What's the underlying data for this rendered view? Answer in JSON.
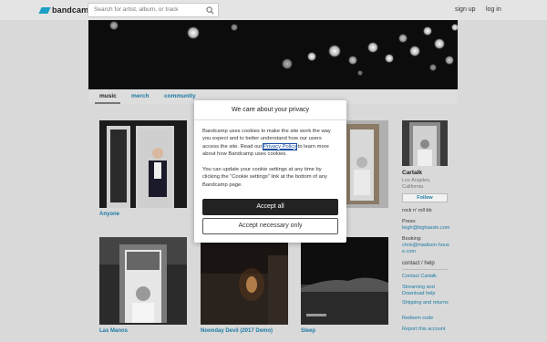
{
  "header": {
    "logo_text": "bandcamp",
    "search_placeholder": "Search for artist, album, or track",
    "signup": "sign up",
    "login": "log in"
  },
  "nav": {
    "music": "music",
    "merch": "merch",
    "community": "community"
  },
  "albums": [
    {
      "title": "Anyone"
    },
    {
      "title": "Las Manos"
    },
    {
      "title": "Noonday Devil (2017 Demo)"
    },
    {
      "title": "Sleep"
    }
  ],
  "sidebar": {
    "name": "Cartalk",
    "location": "Los Angeles, California",
    "follow": "Follow",
    "genre": "rock n' roll bb",
    "press_label": "Press:",
    "press_email": "leigh@bighassle.com",
    "booking_label": "Booking:",
    "booking_email": "chris@madison-house.com",
    "contact_heading": "contact / help",
    "links": [
      "Contact Cartalk",
      "Streaming and Download help",
      "Shipping and returns",
      "Redeem code",
      "Report this account"
    ]
  },
  "modal": {
    "title": "We care about your privacy",
    "p1_before": "Bandcamp uses cookies to make the site work the way you expect and to better understand how our users access the site. Read our ",
    "p1_link": "Privacy Policy",
    "p1_after": " to learn more about how Bandcamp uses cookies.",
    "p2": "You can update your cookie settings at any time by clicking the “Cookie settings” link at the bottom of any Bandcamp page.",
    "accept_all": "Accept all",
    "accept_necessary": "Accept necessary only"
  }
}
